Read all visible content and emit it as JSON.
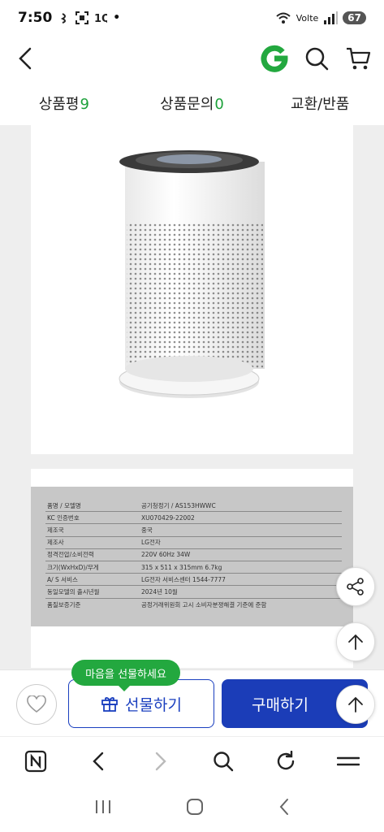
{
  "status": {
    "time": "7:50",
    "icons_left": [
      "vibrate-icon",
      "screenshot-icon",
      "n-icon"
    ],
    "network": "Volte",
    "battery": "67"
  },
  "header": {
    "brand_logo_letter": "G",
    "brand_color": "#23a83f"
  },
  "tabs": [
    {
      "label": "상품평",
      "count": "9"
    },
    {
      "label": "상품문의",
      "count": "0"
    },
    {
      "label": "교환/반품",
      "count": ""
    }
  ],
  "spec": {
    "rows": [
      {
        "key": "품명 / 모델명",
        "value": "공기청정기 / AS153HWWC"
      },
      {
        "key": "KC 인증번호",
        "value": "XU070429-22002"
      },
      {
        "key": "제조국",
        "value": "중국"
      },
      {
        "key": "제조사",
        "value": "LG전자"
      },
      {
        "key": "정격전압/소비전력",
        "value": "220V 60Hz 34W"
      },
      {
        "key": "크기(WxHxD)/무게",
        "value": "315 x 511 x 315mm 6.7kg"
      },
      {
        "key": "A/ S 서비스",
        "value": "LG전자 서비스센터 1544-7777"
      },
      {
        "key": "동일모델의 출시년월",
        "value": "2024년 10월"
      },
      {
        "key": "품질보증기준",
        "value": "공정거래위원회 고시 소비자분쟁해결 기준에 준함"
      }
    ]
  },
  "buy_bar": {
    "gift_bubble": "마음을 선물하세요",
    "gift_label": "선물하기",
    "buy_label": "구매하기"
  },
  "colors": {
    "accent_blue": "#1b3db8",
    "accent_green": "#23a83f"
  }
}
